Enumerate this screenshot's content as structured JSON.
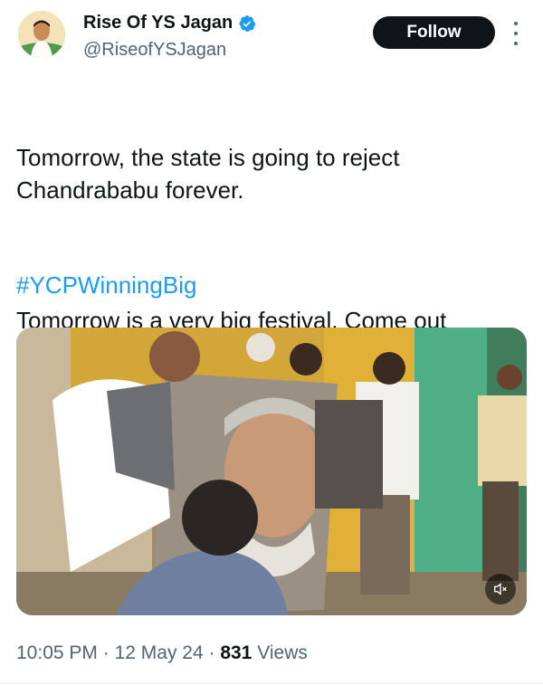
{
  "author": {
    "display_name": "Rise Of YS Jagan",
    "handle": "@RiseofYSJagan",
    "verified": true,
    "avatar_icon": "avatar-image"
  },
  "header": {
    "follow_label": "Follow",
    "more_icon": "more-vertical-icon"
  },
  "tweet": {
    "paragraph1": "Tomorrow, the state is going to reject\nChandrababu forever.",
    "paragraph2": "Tomorrow is a very big festival. Come out\nand celebrate it by voting for fan.",
    "hashtag": "#YCPWinningBig"
  },
  "media": {
    "type": "video",
    "mute_icon": "speaker-muted-icon"
  },
  "meta": {
    "time": "10:05 PM",
    "separator": "·",
    "date": "12 May 24",
    "views_count": "831",
    "views_label": "Views"
  },
  "colors": {
    "text": "#0f1419",
    "secondary": "#536471",
    "link": "#1d9bf0",
    "verified": "#1d9bf0",
    "follow_bg": "#0f1419"
  }
}
